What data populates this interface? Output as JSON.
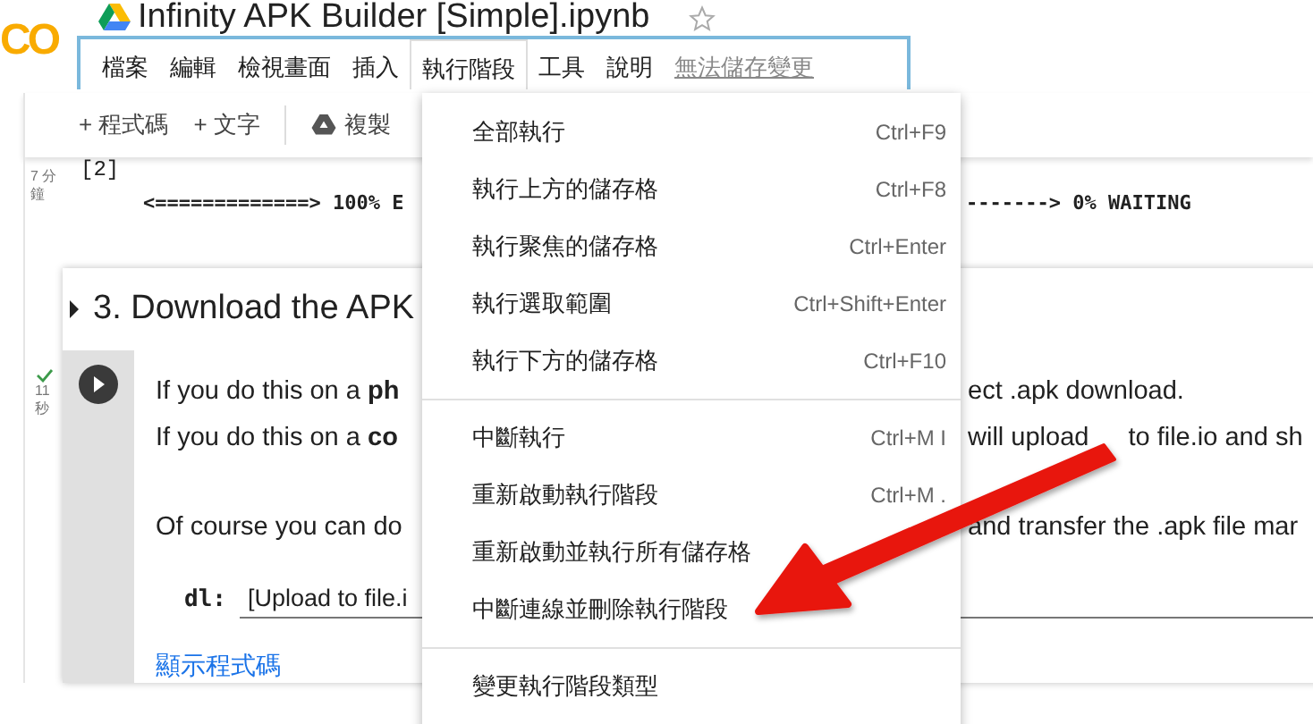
{
  "notebook": {
    "logo": "CO",
    "title": "Infinity APK Builder [Simple].ipynb"
  },
  "menubar": [
    {
      "label": "檔案",
      "selected": false
    },
    {
      "label": "編輯",
      "selected": false
    },
    {
      "label": "檢視畫面",
      "selected": false
    },
    {
      "label": "插入",
      "selected": false
    },
    {
      "label": "執行階段",
      "selected": true
    },
    {
      "label": "工具",
      "selected": false
    },
    {
      "label": "說明",
      "selected": false
    }
  ],
  "save_status": "無法儲存變更",
  "toolbar": {
    "add_buttons": [
      "+ 程式碼",
      "+ 文字"
    ],
    "copy": "複製"
  },
  "output_cell": {
    "elapsed": "7 分鐘",
    "exec_count": "[2]",
    "progress_left": "<=============> 100% E",
    "progress_right": "-------> 0% WAITING"
  },
  "section": {
    "title": "3. Download the APK",
    "elapsed": "11 秒",
    "done": true,
    "lines": [
      {
        "left": "If you do this on a **ph**",
        "right": [
          "ect .apk download."
        ]
      },
      {
        "left": "If you do this on a **co**",
        "right": [
          "will upload",
          "to file.io and sh"
        ]
      },
      {
        "left": "Of course you can do",
        "right": [
          "and transfer the .apk file mar"
        ]
      }
    ],
    "form": {
      "label": "dl:",
      "value": "[Upload to file.i"
    },
    "show_code": "顯示程式碼"
  },
  "menu": {
    "items": [
      {
        "kind": "item",
        "label": "全部執行",
        "shortcut": "Ctrl+F9"
      },
      {
        "kind": "item",
        "label": "執行上方的儲存格",
        "shortcut": "Ctrl+F8"
      },
      {
        "kind": "item",
        "label": "執行聚焦的儲存格",
        "shortcut": "Ctrl+Enter"
      },
      {
        "kind": "item",
        "label": "執行選取範圍",
        "shortcut": "Ctrl+Shift+Enter"
      },
      {
        "kind": "item",
        "label": "執行下方的儲存格",
        "shortcut": "Ctrl+F10"
      },
      {
        "kind": "separator"
      },
      {
        "kind": "item",
        "label": "中斷執行",
        "shortcut": "Ctrl+M I"
      },
      {
        "kind": "item",
        "label": "重新啟動執行階段",
        "shortcut": "Ctrl+M ."
      },
      {
        "kind": "item",
        "label": "重新啟動並執行所有儲存格"
      },
      {
        "kind": "item",
        "label": "中斷連線並刪除執行階段"
      },
      {
        "kind": "separator"
      },
      {
        "kind": "item",
        "label": "變更執行階段類型"
      }
    ]
  }
}
